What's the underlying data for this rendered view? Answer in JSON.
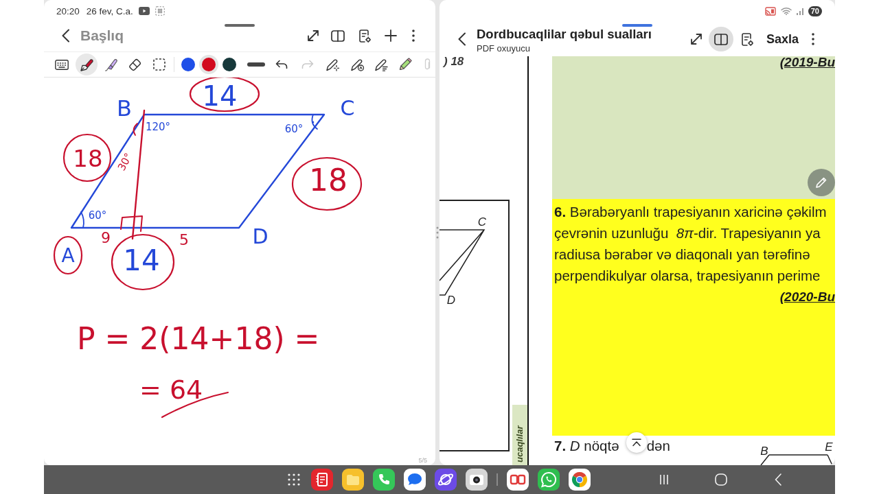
{
  "left_window": {
    "status_bar": {
      "time": "20:20",
      "date": "26 fev, C.a."
    },
    "header": {
      "title_field": {
        "placeholder": "Başlıq"
      },
      "book_view_toggle": {
        "selected": false
      }
    },
    "toolbar": {
      "tools": [
        {
          "kind": "keyboard",
          "selected": false
        },
        {
          "kind": "pen",
          "selected": true
        },
        {
          "kind": "highlighter",
          "selected": false
        },
        {
          "kind": "eraser",
          "selected": false
        },
        {
          "kind": "selection",
          "selected": false
        }
      ],
      "colors": [
        {
          "color": "#1f4fe8",
          "selected": false
        },
        {
          "color": "#d20a1e",
          "selected": true
        },
        {
          "color": "#17393b",
          "selected": false
        }
      ],
      "history": [
        {
          "kind": "undo",
          "disabled": false
        },
        {
          "kind": "redo",
          "disabled": true
        }
      ]
    },
    "canvas": {
      "labels": [
        {
          "text": "14",
          "color": "#2448d8",
          "circled": true
        },
        {
          "text": "B",
          "color": "#2448d8",
          "circled": false
        },
        {
          "text": "C",
          "color": "#2448d8",
          "circled": false
        },
        {
          "text": "120°",
          "color": "#2448d8",
          "circled": false
        },
        {
          "text": "60°",
          "color": "#2448d8",
          "circled": false
        },
        {
          "text": "18",
          "color": "#c8102e",
          "circled": true
        },
        {
          "text": "30°",
          "color": "#c8102e",
          "circled": false
        },
        {
          "text": "18",
          "color": "#c8102e",
          "circled": true
        },
        {
          "text": "60°",
          "color": "#2448d8",
          "circled": false
        },
        {
          "text": "9",
          "color": "#c8102e",
          "circled": false
        },
        {
          "text": "5",
          "color": "#c8102e",
          "circled": false
        },
        {
          "text": "D",
          "color": "#2448d8",
          "circled": false
        },
        {
          "text": "A",
          "color": "#2448d8",
          "circled": true
        },
        {
          "text": "14",
          "color": "#2448d8",
          "circled": true
        }
      ],
      "formula": [
        "P = 2(14+18) =",
        "= 64"
      ],
      "page_indicator": "5/5"
    }
  },
  "right_window": {
    "status_bar": {
      "battery": "70"
    },
    "header": {
      "title": "Dordbucaqlilar qəbul sualları",
      "subtitle": "PDF oxuyucu",
      "book_view_toggle": {
        "selected": true
      },
      "save_button": "Saxla"
    },
    "document": {
      "left_column": {
        "answer_fragment": ") 18",
        "figure_labels": [
          "C",
          "D"
        ],
        "side_tab": "ucaqlılar"
      },
      "question_above": {
        "source": "(2019-Bu"
      },
      "question_6": {
        "lines": [
          "**6.** Bərabəryanlı trapesiyanın xaricinə çəkilm",
          "çevrənin uzunluğu  *8π*-dir. Trapesiyanın ya",
          "radiusa bərabər və diaqonalı yan tərəfinə",
          "perpendikulyar olarsa, trapesiyanın perime"
        ],
        "source": "(2020-Bu"
      },
      "question_7": {
        "text_before": "**7.** *D* nöqtə",
        "text_after": "dən",
        "figure_labels": [
          "B",
          "E"
        ]
      }
    }
  },
  "taskbar": {
    "apps": [
      {
        "kind": "notes"
      },
      {
        "kind": "files"
      },
      {
        "kind": "phone"
      },
      {
        "kind": "messages"
      },
      {
        "kind": "internet"
      },
      {
        "kind": "camera"
      },
      {
        "kind": "divider"
      },
      {
        "kind": "dual-app"
      },
      {
        "kind": "chat"
      },
      {
        "kind": "web"
      }
    ]
  }
}
